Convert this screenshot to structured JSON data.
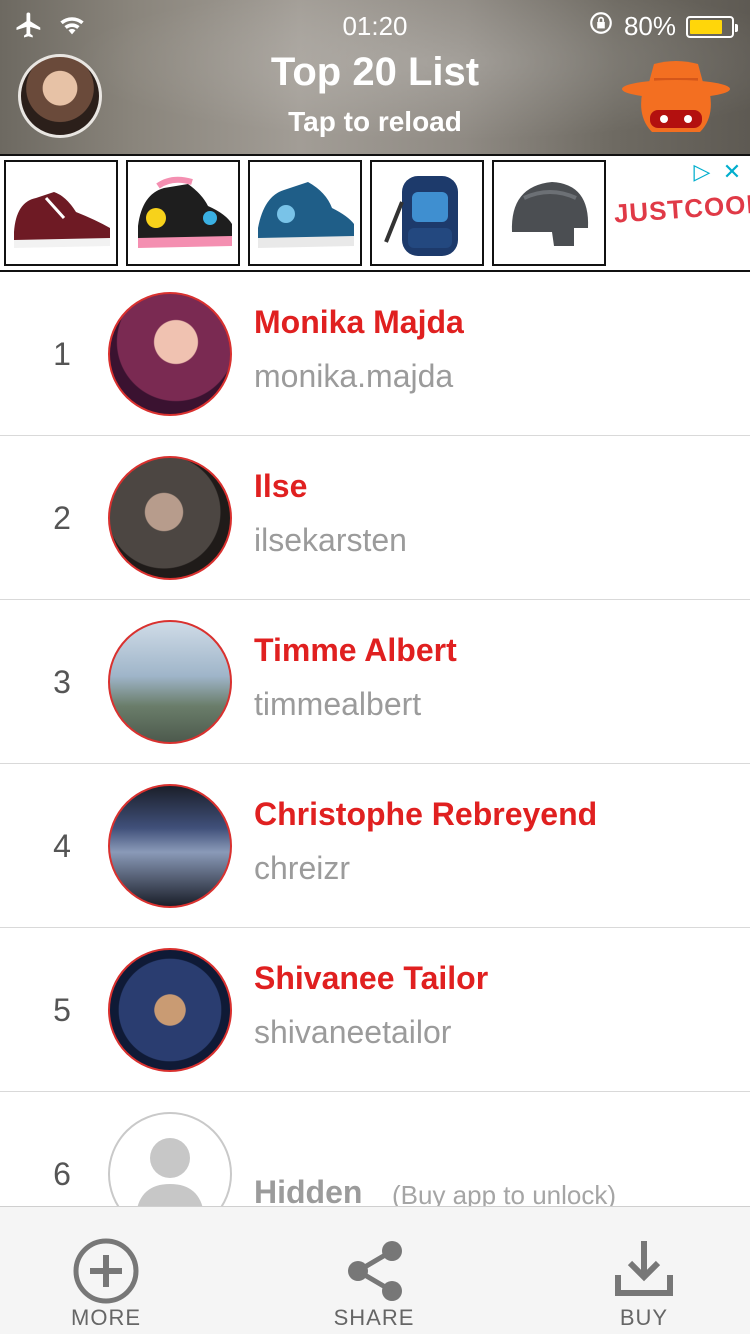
{
  "status_bar": {
    "time": "01:20",
    "battery_percent": "80%",
    "battery_level": 0.8
  },
  "header": {
    "title": "Top 20 List",
    "subtitle": "Tap to reload"
  },
  "ad": {
    "brand": "JUSTCOOL!",
    "items": [
      "sneaker-red",
      "heelys-pink",
      "heelys-blue",
      "backpack-blue",
      "helmet-grey"
    ]
  },
  "list": [
    {
      "rank": "1",
      "name": "Monika Majda",
      "handle": "monika.majda",
      "avatar_color": "#7a2a52"
    },
    {
      "rank": "2",
      "name": "Ilse",
      "handle": "ilsekarsten",
      "avatar_color": "#4c4642"
    },
    {
      "rank": "3",
      "name": "Timme Albert",
      "handle": "timmealbert",
      "avatar_color": "#8ba6bf"
    },
    {
      "rank": "4",
      "name": "Christophe Rebreyend",
      "handle": "chreizr",
      "avatar_color": "#2b2f3a"
    },
    {
      "rank": "5",
      "name": "Shivanee Tailor",
      "handle": "shivaneetailor",
      "avatar_color": "#1c2f58"
    }
  ],
  "hidden_row": {
    "rank": "6",
    "name": "Hidden",
    "note": "(Buy app to unlock)"
  },
  "tabbar": {
    "more": "MORE",
    "share": "SHARE",
    "buy": "BUY"
  },
  "colors": {
    "accent_red": "#e02020",
    "handle_grey": "#9b9b9b",
    "spy_orange": "#f36f21"
  }
}
